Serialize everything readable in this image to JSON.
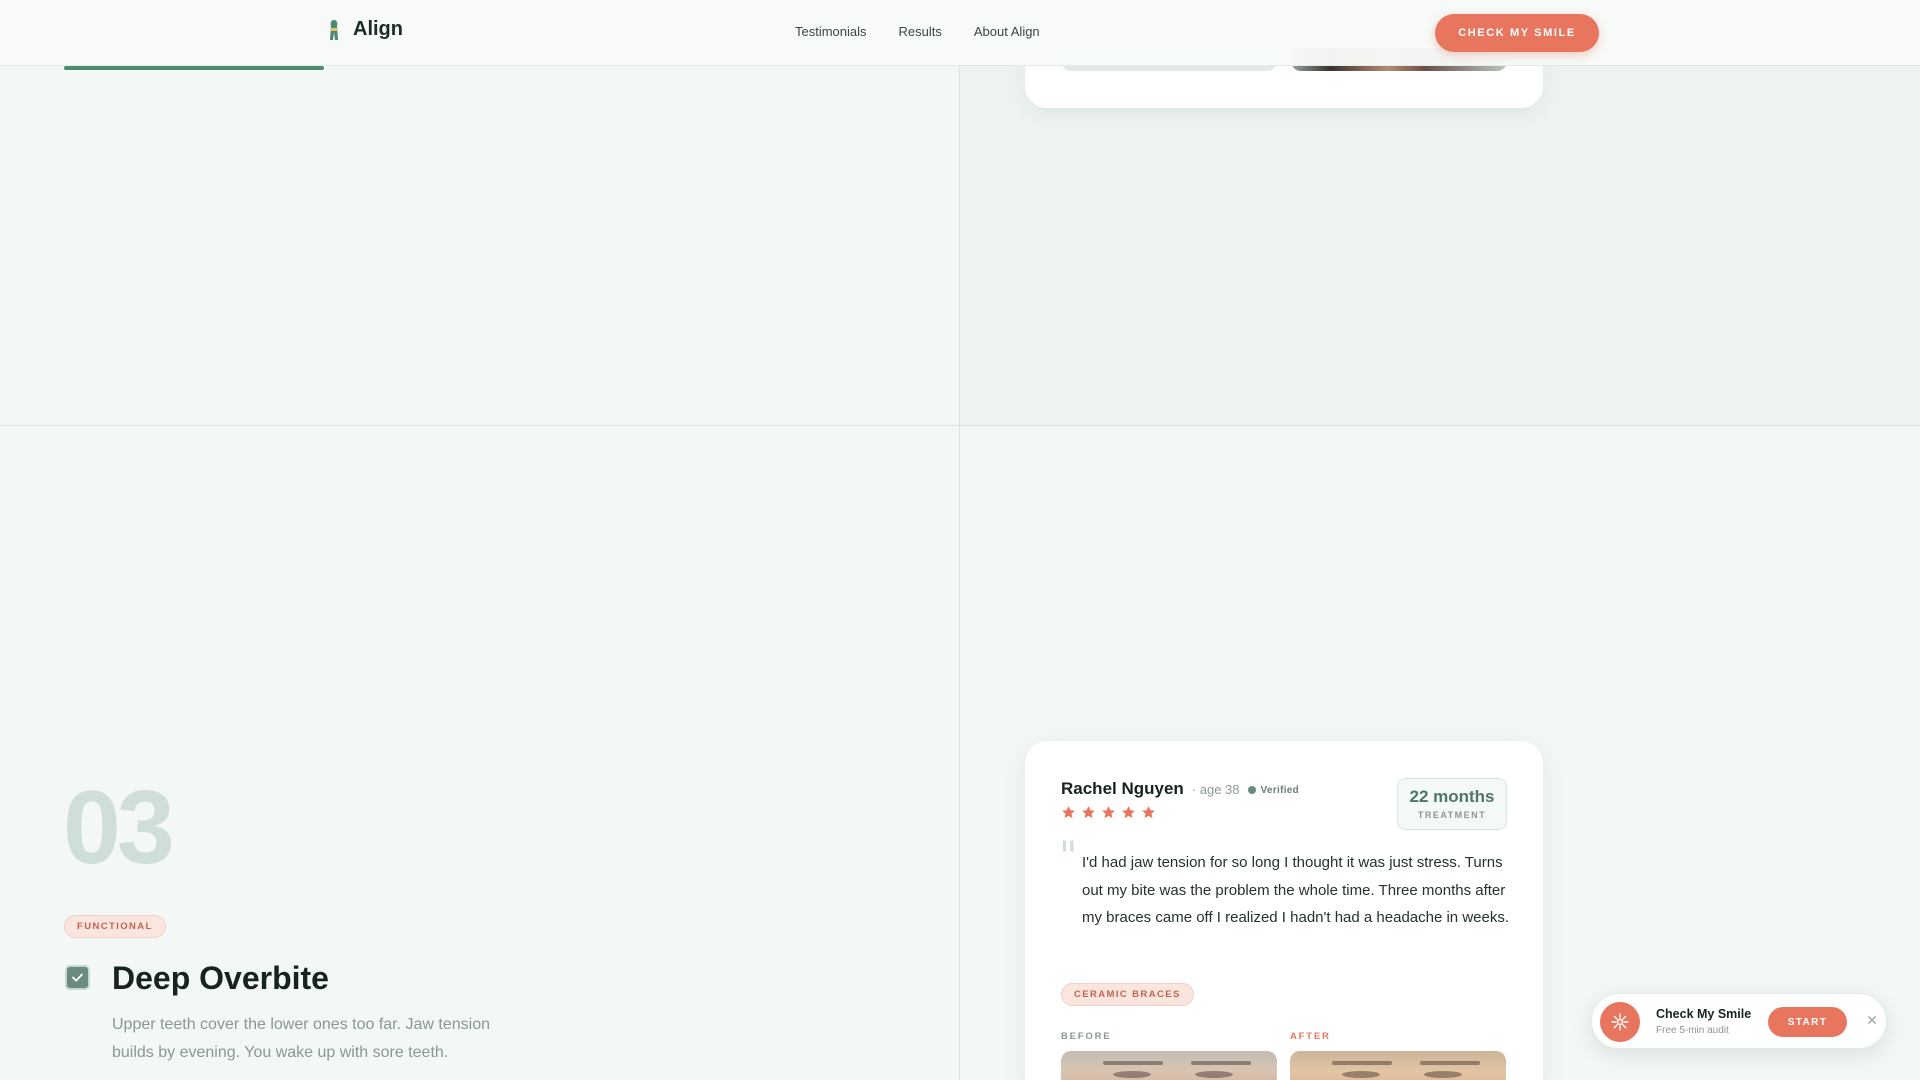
{
  "header": {
    "brand": "Align",
    "brand_icon": "tooth-icon",
    "nav": [
      "Testimonials",
      "Results",
      "About Align"
    ],
    "cta_label": "CHECK MY SMILE",
    "scroll_progress": 0.29
  },
  "colors": {
    "accent": "#e8765f",
    "brand_green": "#4d8a72",
    "page_bg": "#f3f7f5"
  },
  "issue": {
    "number": "03",
    "tag": "FUNCTIONAL",
    "checked": true,
    "title": "Deep Overbite",
    "description": "Upper teeth cover the lower ones too far. Jaw tension builds by evening. You wake up with sore teeth."
  },
  "testimonial": {
    "name": "Rachel Nguyen",
    "age": "· age 38",
    "verified": "Verified",
    "rating": 5,
    "duration_value": "22 months",
    "duration_label": "TREATMENT",
    "quote": "I'd had jaw tension for so long I thought it was just stress. Turns out my bite was the problem the whole time. Three months after my braces came off I realized I hadn't had a headache in weeks.",
    "treatment_tag": "CERAMIC BRACES",
    "before_label": "BEFORE",
    "after_label": "AFTER"
  },
  "widget": {
    "icon": "sparkle-icon",
    "title": "Check My Smile",
    "subtitle": "Free 5-min audit",
    "start_label": "START",
    "close_icon": "close-icon"
  }
}
